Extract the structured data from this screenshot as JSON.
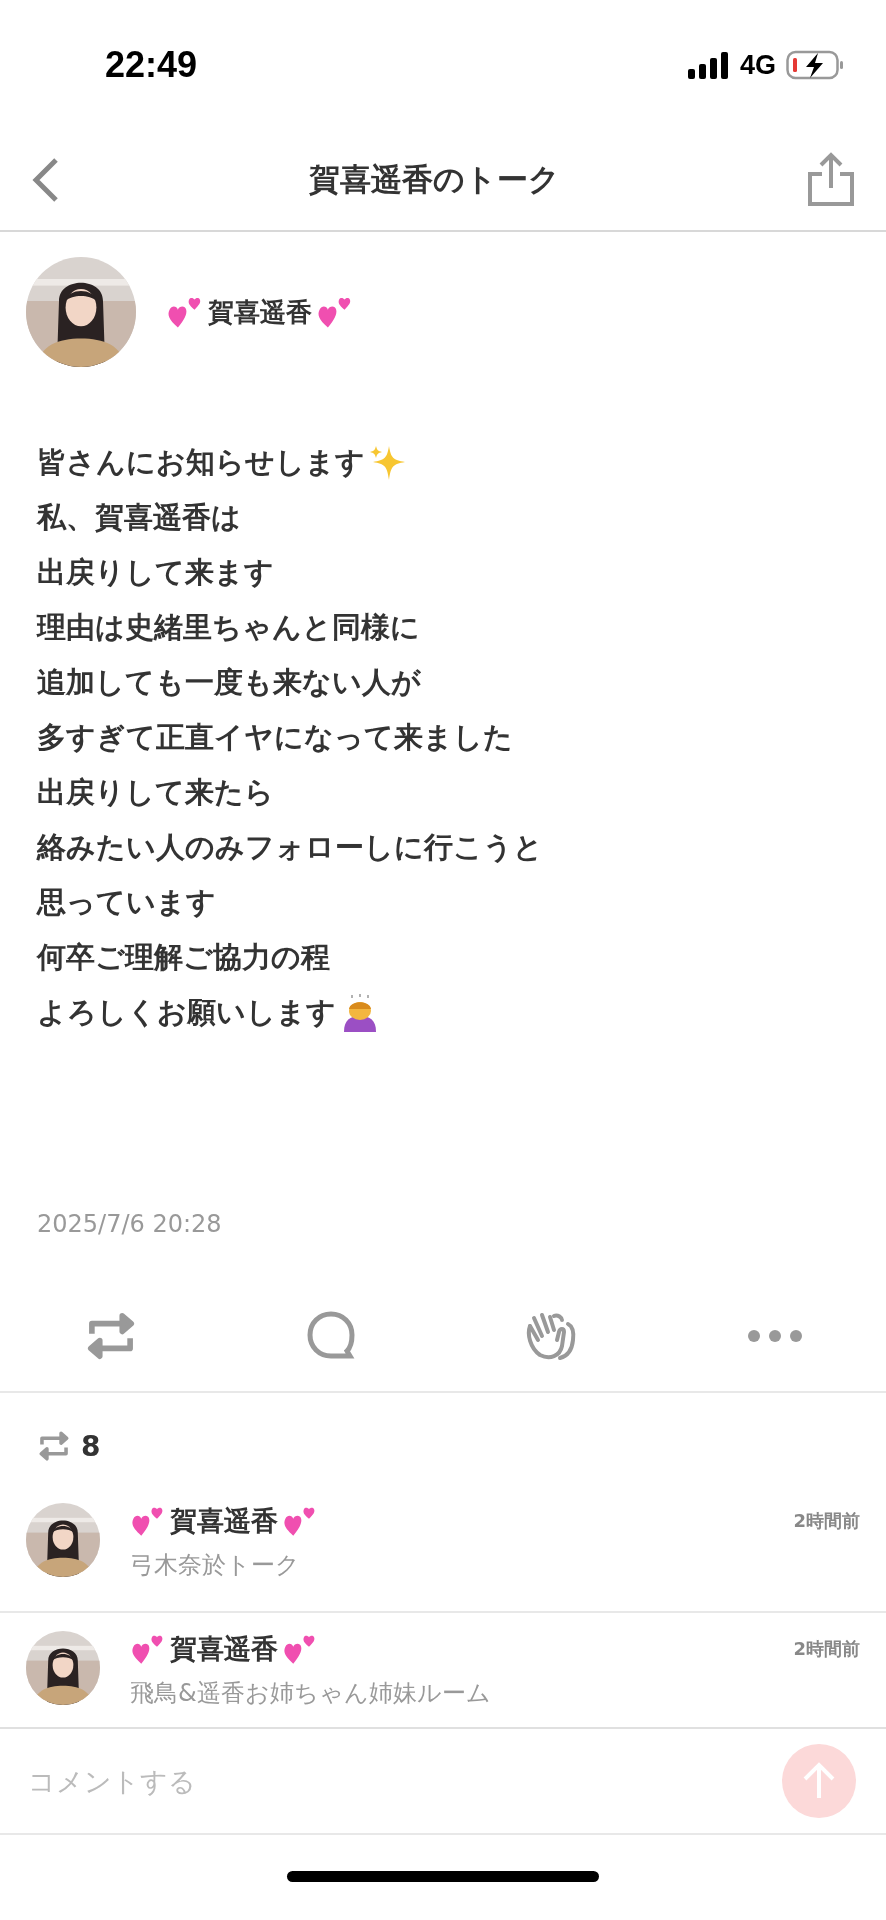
{
  "status_bar": {
    "time": "22:49",
    "network": "4G"
  },
  "header": {
    "title": "賀喜遥香のトーク"
  },
  "post": {
    "author": "賀喜遥香",
    "lines": [
      "皆さんにお知らせします",
      "私、賀喜遥香は",
      "出戻りして来ます",
      "理由は史緒里ちゃんと同様に",
      "追加しても一度も来ない人が",
      "多すぎて正直イヤになって来ました",
      "出戻りして来たら",
      "絡みたい人のみフォローしに行こうと",
      "思っています",
      "何卒ご理解ご協力の程",
      "よろしくお願いします"
    ],
    "timestamp": "2025/7/6 20:28"
  },
  "repost_count": "8",
  "reposts": [
    {
      "name": "賀喜遥香",
      "subtitle": "弓木奈於トーク",
      "time": "2時間前"
    },
    {
      "name": "賀喜遥香",
      "subtitle": "飛鳥&遥香お姉ちゃん姉妹ルーム",
      "time": "2時間前"
    }
  ],
  "comment_bar": {
    "placeholder": "コメントする",
    "send_disabled": true
  }
}
